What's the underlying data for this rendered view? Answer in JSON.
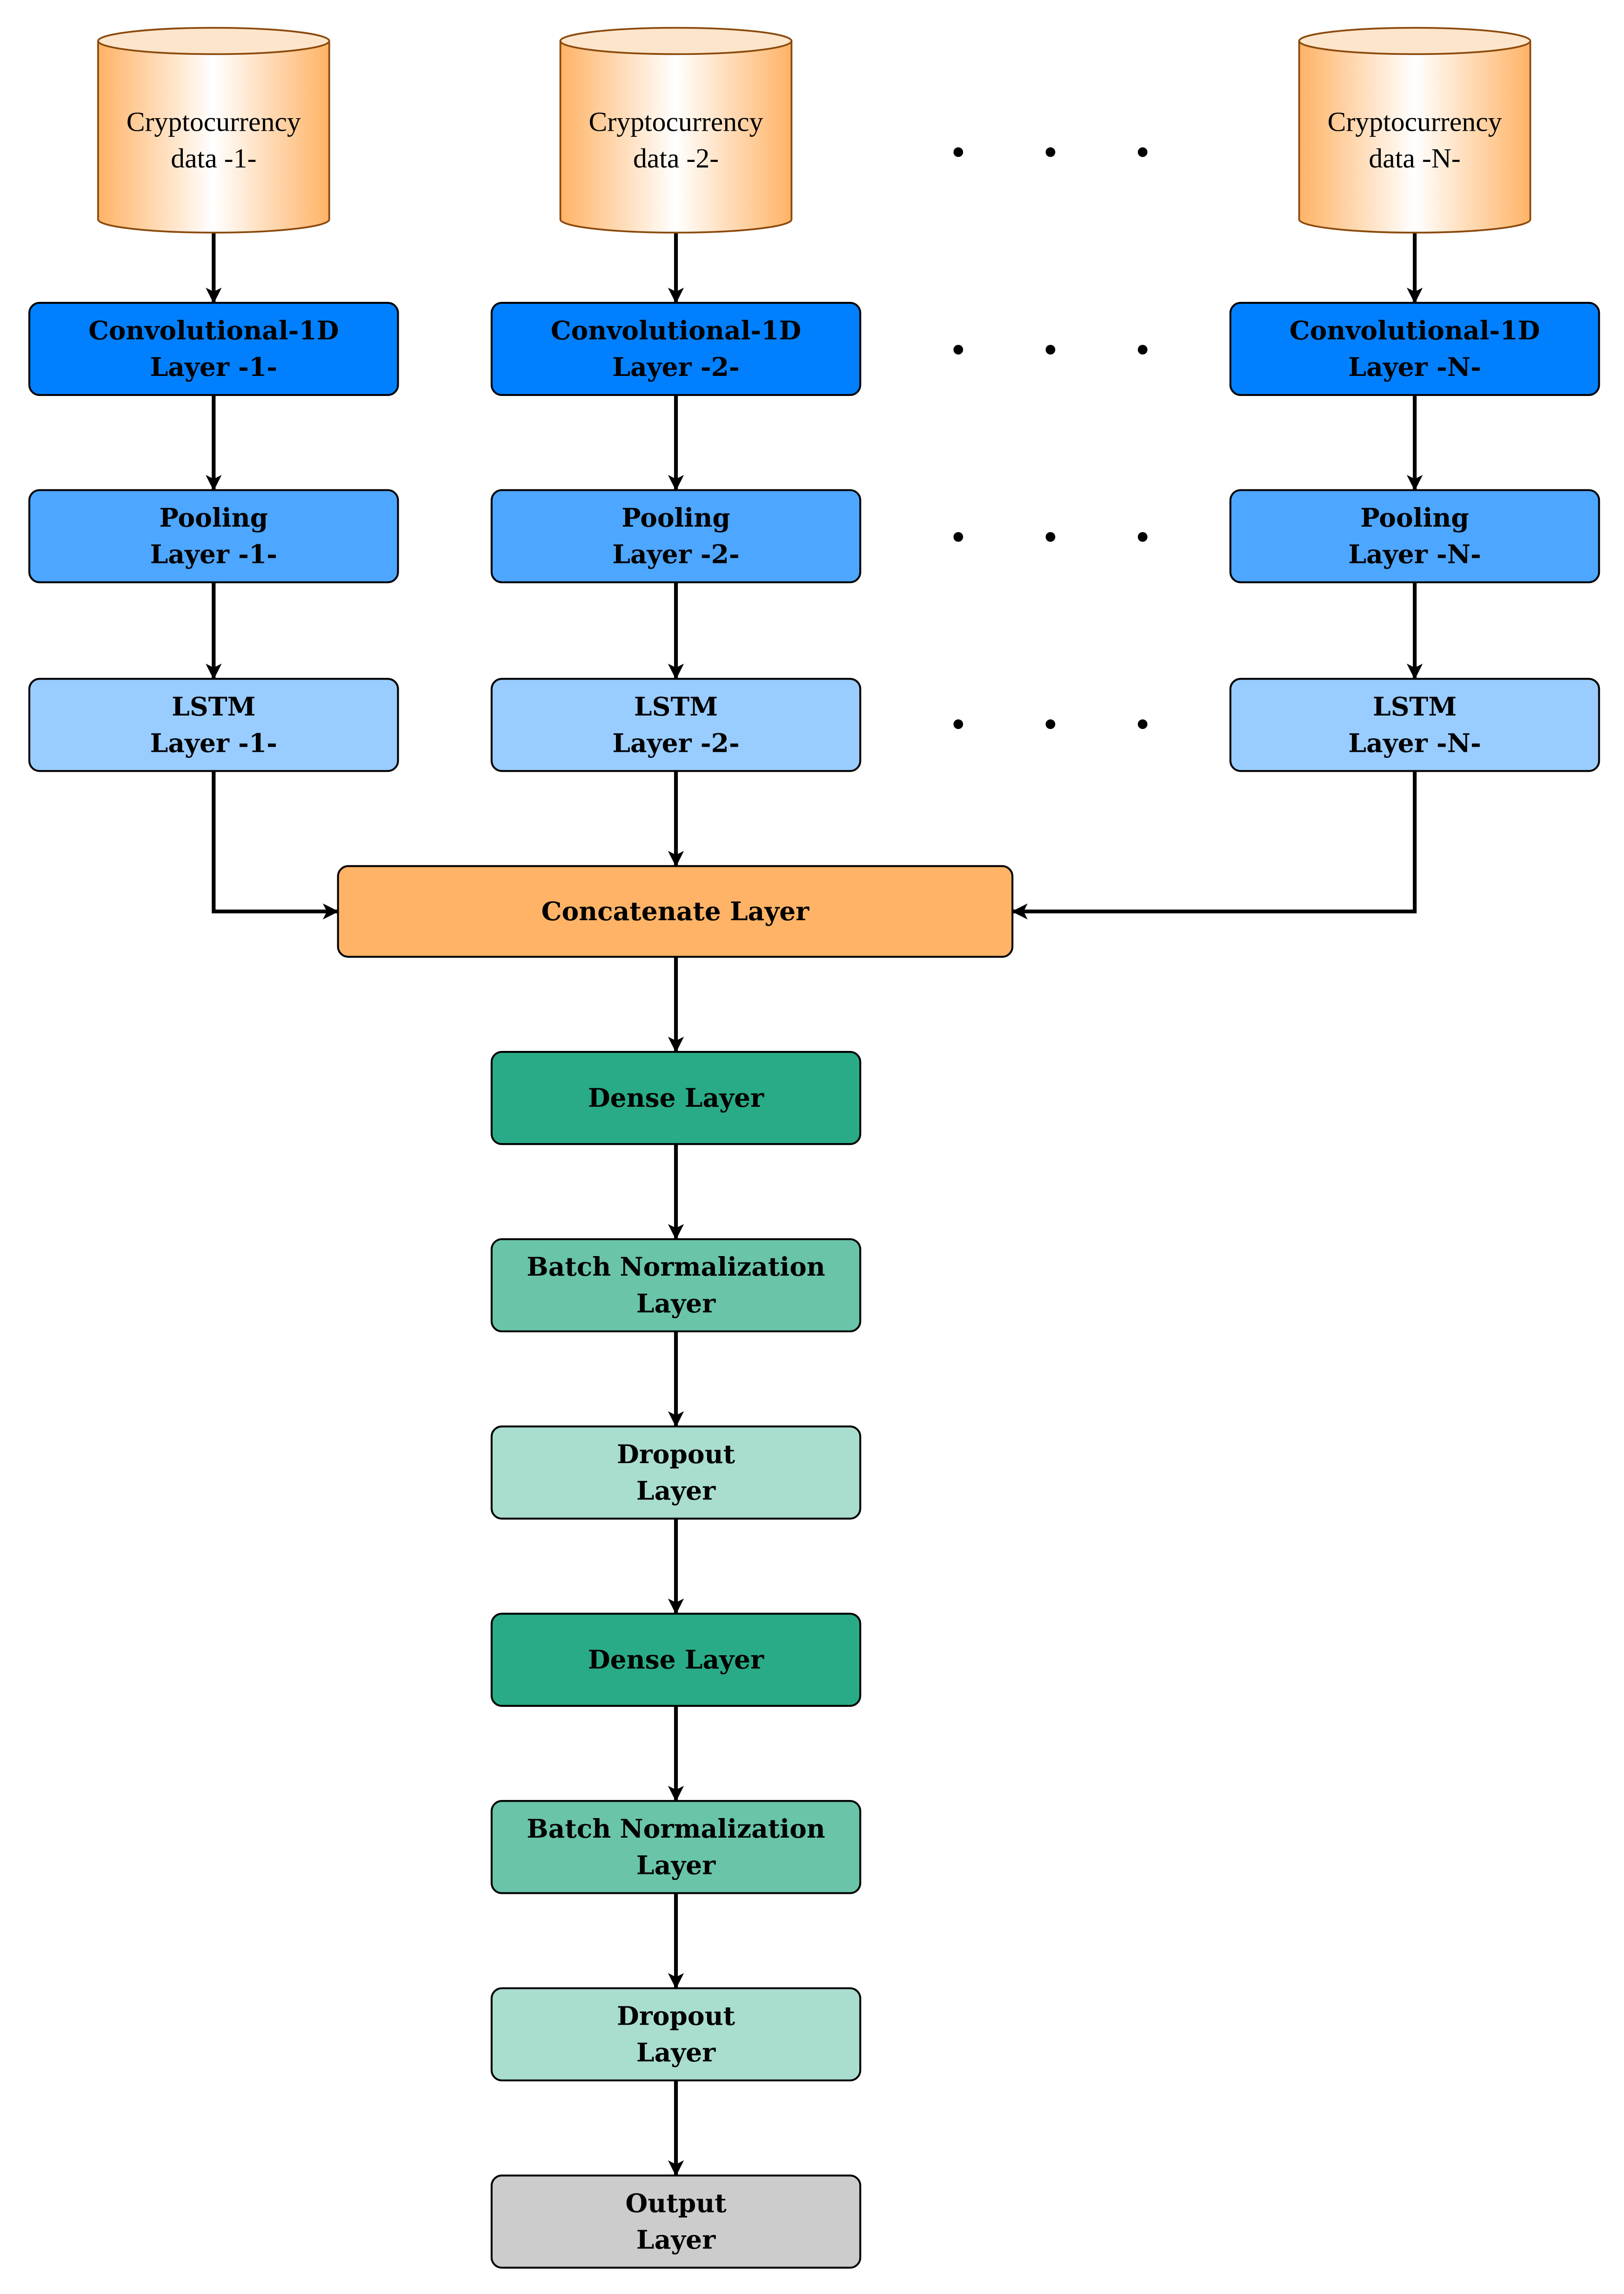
{
  "diagram": {
    "type": "neural-network-architecture",
    "branches": [
      {
        "id": "1",
        "data_source": [
          "Cryptocurrency",
          "data -1-"
        ],
        "conv": [
          "Convolutional-1D",
          "Layer -1-"
        ],
        "pool": [
          "Pooling",
          "Layer -1-"
        ],
        "lstm": [
          "LSTM",
          "Layer -1-"
        ]
      },
      {
        "id": "2",
        "data_source": [
          "Cryptocurrency",
          "data -2-"
        ],
        "conv": [
          "Convolutional-1D",
          "Layer -2-"
        ],
        "pool": [
          "Pooling",
          "Layer -2-"
        ],
        "lstm": [
          "LSTM",
          "Layer -2-"
        ]
      },
      {
        "id": "N",
        "data_source": [
          "Cryptocurrency",
          "data -N-"
        ],
        "conv": [
          "Convolutional-1D",
          "Layer -N-"
        ],
        "pool": [
          "Pooling",
          "Layer -N-"
        ],
        "lstm": [
          "LSTM",
          "Layer -N-"
        ]
      }
    ],
    "ellipsis_rows": 4,
    "merge": {
      "label": [
        "Concatenate Layer"
      ]
    },
    "head": [
      {
        "kind": "dense",
        "label": [
          "Dense Layer"
        ]
      },
      {
        "kind": "batchnorm",
        "label": [
          "Batch Normalization",
          "Layer"
        ]
      },
      {
        "kind": "dropout",
        "label": [
          "Dropout",
          "Layer"
        ]
      },
      {
        "kind": "dense",
        "label": [
          "Dense Layer"
        ]
      },
      {
        "kind": "batchnorm",
        "label": [
          "Batch Normalization",
          "Layer"
        ]
      },
      {
        "kind": "dropout",
        "label": [
          "Dropout",
          "Layer"
        ]
      },
      {
        "kind": "output",
        "label": [
          "Output",
          "Layer"
        ]
      }
    ],
    "colors": {
      "cylinder_edge": "#ffb366",
      "cylinder_center": "#ffffff",
      "cylinder_stroke": "#8b4a0c",
      "conv": "#0080ff",
      "pool": "#4da6ff",
      "lstm": "#99ccff",
      "concat": "#ffb366",
      "dense": "#29ab87",
      "batchnorm": "#69c4a9",
      "dropout": "#a9ddd0",
      "output": "#cccccc",
      "edge": "#000000"
    }
  }
}
